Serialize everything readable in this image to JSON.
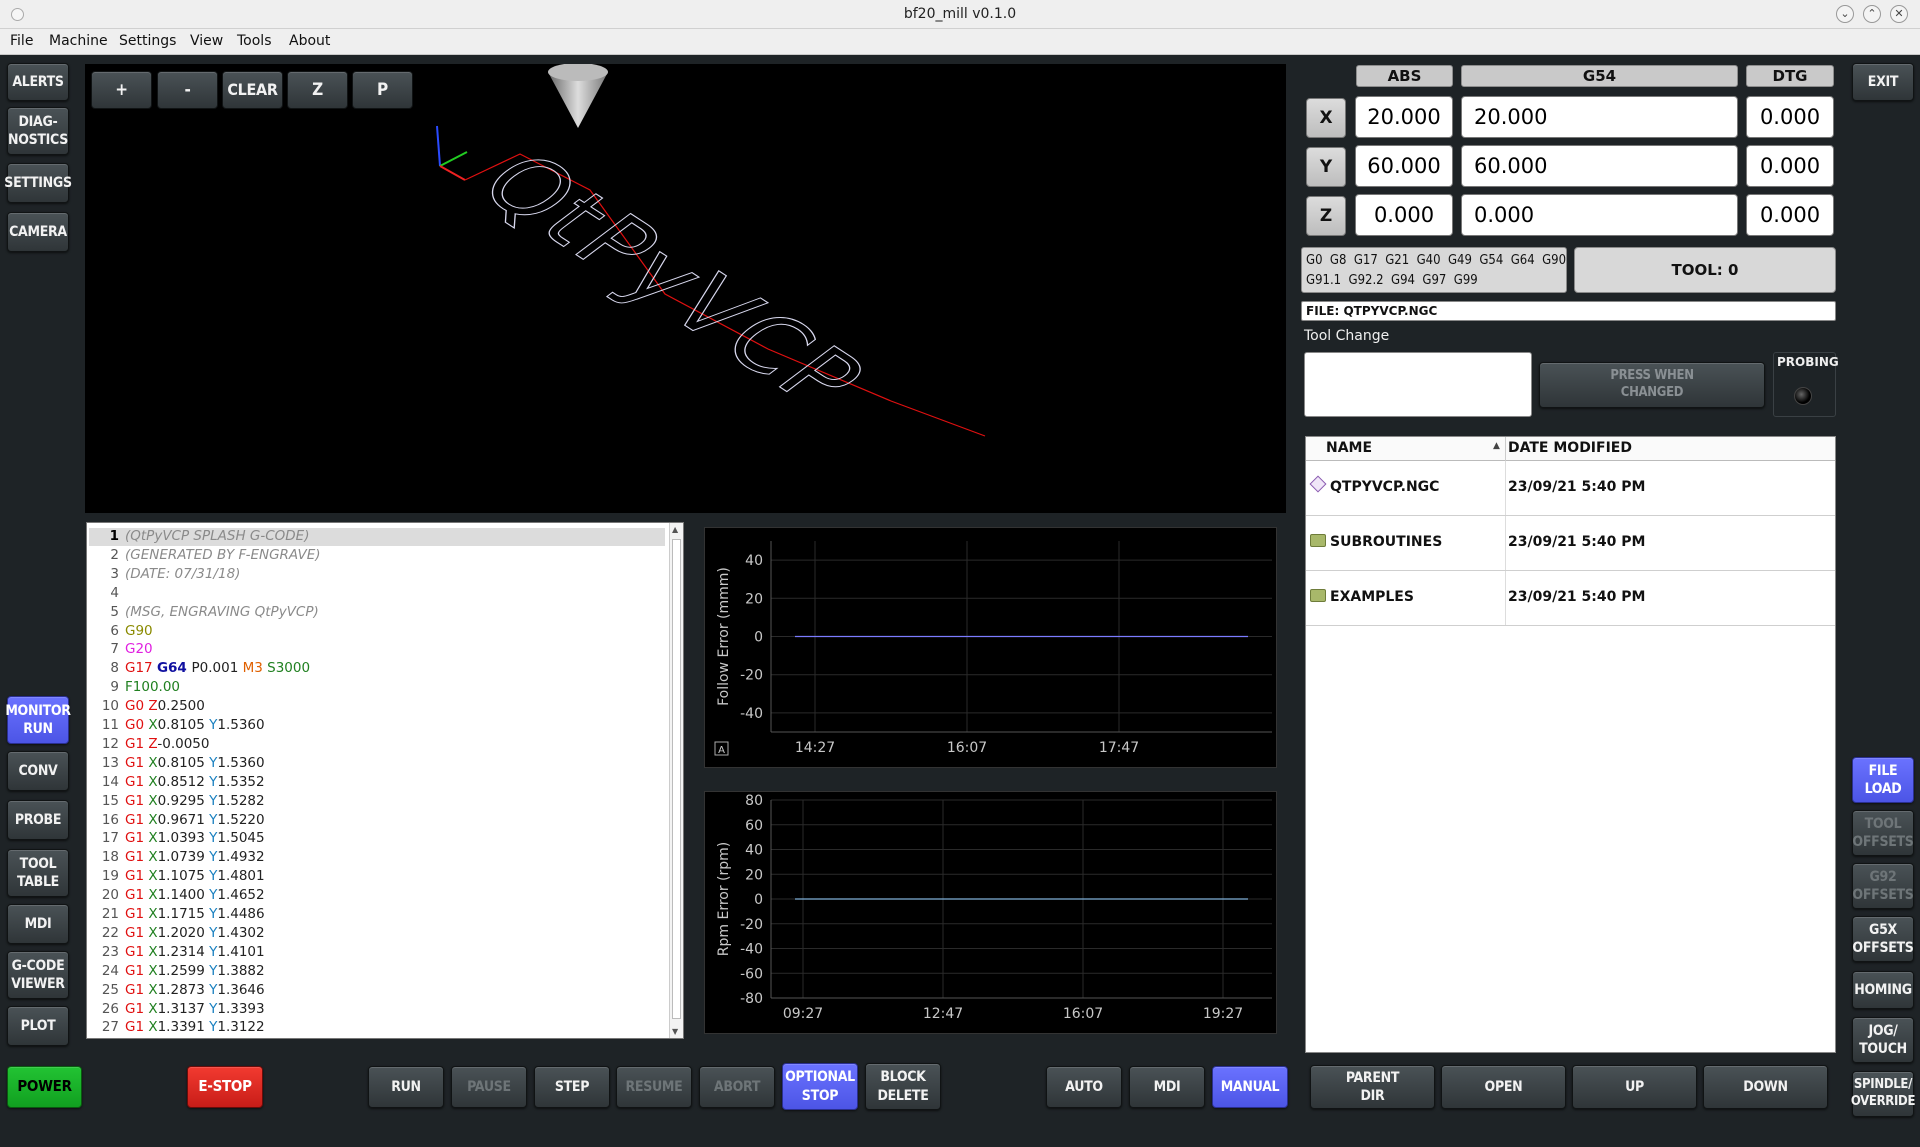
{
  "window": {
    "title": "bf20_mill v0.1.0"
  },
  "menu": [
    "File",
    "Machine",
    "Settings",
    "View",
    "Tools",
    "About"
  ],
  "left_top_buttons": [
    "ALERTS",
    "DIAG-\nNOSTICS",
    "SETTINGS",
    "CAMERA"
  ],
  "left_bottom_buttons": [
    "MONITOR\nRUN",
    "CONV",
    "PROBE",
    "TOOL\nTABLE",
    "MDI",
    "G-CODE\nVIEWER",
    "PLOT"
  ],
  "viewer_toolbar": [
    "+",
    "-",
    "CLEAR",
    "Z",
    "P"
  ],
  "dro": {
    "headers": {
      "abs": "ABS",
      "g54": "G54",
      "dtg": "DTG"
    },
    "rows": [
      {
        "axis": "X",
        "abs": "20.000",
        "g54": "20.000",
        "dtg": "0.000"
      },
      {
        "axis": "Y",
        "abs": "60.000",
        "g54": "60.000",
        "dtg": "0.000"
      },
      {
        "axis": "Z",
        "abs": "0.000",
        "g54": "0.000",
        "dtg": "0.000"
      }
    ]
  },
  "active_codes": {
    "line1": "G0  G8  G17  G21  G40  G49  G54  G64  G90",
    "line2": "G91.1  G92.2  G94  G97  G99"
  },
  "tool": "TOOL: 0",
  "file_label": "FILE: QTPYVCP.NGC",
  "tool_change": {
    "label": "Tool Change",
    "button": "PRESS WHEN\nCHANGED",
    "probing": "PROBING"
  },
  "file_browser": {
    "headers": {
      "name": "NAME",
      "date": "DATE MODIFIED"
    },
    "rows": [
      {
        "icon": "file-icon",
        "name": "QTPYVCP.NGC",
        "date": "23/09/21 5:40 PM"
      },
      {
        "icon": "folder-icon",
        "name": "SUBROUTINES",
        "date": "23/09/21 5:40 PM"
      },
      {
        "icon": "folder-icon",
        "name": "EXAMPLES",
        "date": "23/09/21 5:40 PM"
      }
    ]
  },
  "right_buttons": {
    "exit": "EXIT",
    "side": [
      "FILE\nLOAD",
      "TOOL\nOFFSETS",
      "G92\nOFFSETS",
      "G5X\nOFFSETS",
      "HOMING",
      "JOG/\nTOUCH",
      "SPINDLE/\nOVERRIDE"
    ]
  },
  "bottom_bar": {
    "power": "POWER",
    "estop": "E-STOP",
    "program": [
      "RUN",
      "PAUSE",
      "STEP",
      "RESUME",
      "ABORT",
      "OPTIONAL\nSTOP",
      "BLOCK\nDELETE"
    ],
    "modes": [
      "AUTO",
      "MDI",
      "MANUAL"
    ],
    "nav": [
      "PARENT\nDIR",
      "OPEN",
      "UP",
      "DOWN"
    ]
  },
  "gcode": [
    [
      [
        "(QtPyVCP SPLASH G-CODE)",
        "c"
      ]
    ],
    [
      [
        "(GENERATED BY F-ENGRAVE)",
        "c"
      ]
    ],
    [
      [
        "(DATE: 07/31/18)",
        "c"
      ]
    ],
    [],
    [
      [
        "(MSG, ENGRAVING QtPyVCP)",
        "c"
      ]
    ],
    [
      [
        "G90",
        "o"
      ]
    ],
    [
      [
        "G20",
        "m"
      ]
    ],
    [
      [
        "G17 ",
        "r"
      ],
      [
        "G64 ",
        "b"
      ],
      [
        "P0.001 ",
        "k"
      ],
      [
        "M3 ",
        "or"
      ],
      [
        "S3000",
        "g"
      ]
    ],
    [
      [
        "F100.00",
        "g"
      ]
    ],
    [
      [
        "G0 ",
        "r"
      ],
      [
        "Z",
        "r"
      ],
      [
        "0.2500",
        "k"
      ]
    ],
    [
      [
        "G0 ",
        "r"
      ],
      [
        "X",
        "g"
      ],
      [
        "0.8105 ",
        "k"
      ],
      [
        "Y",
        "bl"
      ],
      [
        "1.5360",
        "k"
      ]
    ],
    [
      [
        "G1 ",
        "r"
      ],
      [
        "Z",
        "r"
      ],
      [
        "-0.0050",
        "k"
      ]
    ],
    [
      [
        "G1 ",
        "r"
      ],
      [
        "X",
        "g"
      ],
      [
        "0.8105 ",
        "k"
      ],
      [
        "Y",
        "bl"
      ],
      [
        "1.5360",
        "k"
      ]
    ],
    [
      [
        "G1 ",
        "r"
      ],
      [
        "X",
        "g"
      ],
      [
        "0.8512 ",
        "k"
      ],
      [
        "Y",
        "bl"
      ],
      [
        "1.5352",
        "k"
      ]
    ],
    [
      [
        "G1 ",
        "r"
      ],
      [
        "X",
        "g"
      ],
      [
        "0.9295 ",
        "k"
      ],
      [
        "Y",
        "bl"
      ],
      [
        "1.5282",
        "k"
      ]
    ],
    [
      [
        "G1 ",
        "r"
      ],
      [
        "X",
        "g"
      ],
      [
        "0.9671 ",
        "k"
      ],
      [
        "Y",
        "bl"
      ],
      [
        "1.5220",
        "k"
      ]
    ],
    [
      [
        "G1 ",
        "r"
      ],
      [
        "X",
        "g"
      ],
      [
        "1.0393 ",
        "k"
      ],
      [
        "Y",
        "bl"
      ],
      [
        "1.5045",
        "k"
      ]
    ],
    [
      [
        "G1 ",
        "r"
      ],
      [
        "X",
        "g"
      ],
      [
        "1.0739 ",
        "k"
      ],
      [
        "Y",
        "bl"
      ],
      [
        "1.4932",
        "k"
      ]
    ],
    [
      [
        "G1 ",
        "r"
      ],
      [
        "X",
        "g"
      ],
      [
        "1.1075 ",
        "k"
      ],
      [
        "Y",
        "bl"
      ],
      [
        "1.4801",
        "k"
      ]
    ],
    [
      [
        "G1 ",
        "r"
      ],
      [
        "X",
        "g"
      ],
      [
        "1.1400 ",
        "k"
      ],
      [
        "Y",
        "bl"
      ],
      [
        "1.4652",
        "k"
      ]
    ],
    [
      [
        "G1 ",
        "r"
      ],
      [
        "X",
        "g"
      ],
      [
        "1.1715 ",
        "k"
      ],
      [
        "Y",
        "bl"
      ],
      [
        "1.4486",
        "k"
      ]
    ],
    [
      [
        "G1 ",
        "r"
      ],
      [
        "X",
        "g"
      ],
      [
        "1.2020 ",
        "k"
      ],
      [
        "Y",
        "bl"
      ],
      [
        "1.4302",
        "k"
      ]
    ],
    [
      [
        "G1 ",
        "r"
      ],
      [
        "X",
        "g"
      ],
      [
        "1.2314 ",
        "k"
      ],
      [
        "Y",
        "bl"
      ],
      [
        "1.4101",
        "k"
      ]
    ],
    [
      [
        "G1 ",
        "r"
      ],
      [
        "X",
        "g"
      ],
      [
        "1.2599 ",
        "k"
      ],
      [
        "Y",
        "bl"
      ],
      [
        "1.3882",
        "k"
      ]
    ],
    [
      [
        "G1 ",
        "r"
      ],
      [
        "X",
        "g"
      ],
      [
        "1.2873 ",
        "k"
      ],
      [
        "Y",
        "bl"
      ],
      [
        "1.3646",
        "k"
      ]
    ],
    [
      [
        "G1 ",
        "r"
      ],
      [
        "X",
        "g"
      ],
      [
        "1.3137 ",
        "k"
      ],
      [
        "Y",
        "bl"
      ],
      [
        "1.3393",
        "k"
      ]
    ],
    [
      [
        "G1 ",
        "r"
      ],
      [
        "X",
        "g"
      ],
      [
        "1.3391 ",
        "k"
      ],
      [
        "Y",
        "bl"
      ],
      [
        "1.3122",
        "k"
      ]
    ]
  ],
  "syntax_colors": {
    "c": "#8a8a8a",
    "o": "#8a8a00",
    "m": "#e020e0",
    "r": "#e01010",
    "b": "#1010a0",
    "k": "#222222",
    "or": "#e06000",
    "g": "#208020",
    "bl": "#1a80c0"
  },
  "chart_data": [
    {
      "type": "line",
      "ylabel": "Follow Error (mmm)",
      "yticks": [
        "40",
        "20",
        "0",
        "-20",
        "-40"
      ],
      "ylim": [
        -50,
        50
      ],
      "xticks": [
        "14:27",
        "16:07",
        "17:47"
      ],
      "series": [
        {
          "values": [
            0,
            0
          ]
        }
      ],
      "color": "#7b7bff",
      "corner_label": "A"
    },
    {
      "type": "line",
      "ylabel": "Rpm Error (rpm)",
      "yticks": [
        "80",
        "60",
        "40",
        "20",
        "0",
        "-20",
        "-40",
        "-60",
        "-80"
      ],
      "ylim": [
        -80,
        80
      ],
      "xticks": [
        "09:27",
        "12:47",
        "16:07",
        "19:27"
      ],
      "series": [
        {
          "values": [
            0,
            0
          ]
        }
      ],
      "color": "#7fb0d8"
    }
  ]
}
